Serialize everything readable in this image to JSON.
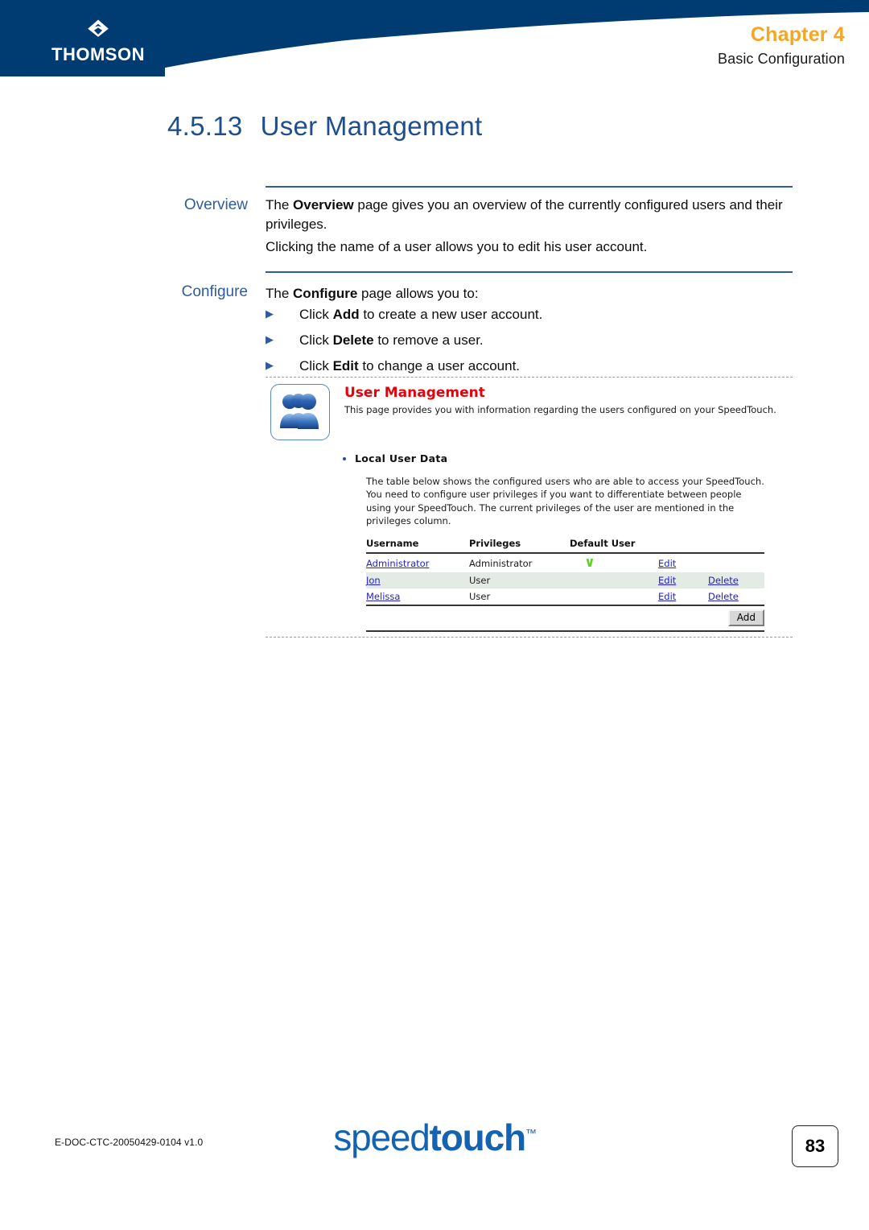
{
  "header": {
    "brand": "THOMSON",
    "brand_mark_icon": "thomson-diamond-icon",
    "chapter_label": "Chapter",
    "chapter_number": "4",
    "chapter_subtitle": "Basic Configuration",
    "chapter_color": "#F5A623",
    "background_color": "#003B71"
  },
  "doc": {
    "section_number": "4.5.13",
    "section_title": "User Management",
    "title_color": "#1F4E8C"
  },
  "overview": {
    "label": "Overview",
    "paragraph_1_pre": "The ",
    "paragraph_1_bold": "Overview",
    "paragraph_1_post": " page gives you an overview of the currently configured users and their privileges.",
    "paragraph_2": "Clicking the name of a user allows you to edit his user account."
  },
  "configure": {
    "label": "Configure",
    "intro_pre": "The ",
    "intro_bold": "Configure",
    "intro_post": " page allows you to:",
    "bullet_marker": "▶",
    "bullets": [
      {
        "pre": "Click ",
        "bold": "Add",
        "post": " to create a new user account."
      },
      {
        "pre": "Click ",
        "bold": "Delete",
        "post": " to remove a user."
      },
      {
        "pre": "Click ",
        "bold": "Edit",
        "post": " to change a user account."
      }
    ]
  },
  "screenshot": {
    "icon": "users-group-icon",
    "title": "User Management",
    "title_color": "#E8000B",
    "lead": "This page provides you with information regarding the users configured on your SpeedTouch.",
    "subsection": "Local User Data",
    "description": "The table below shows the configured users who are able to access your SpeedTouch. You need to configure user privileges if you want to differentiate between people using your SpeedTouch. The current privileges of the user are mentioned in the privileges column.",
    "table": {
      "columns": [
        "Username",
        "Privileges",
        "Default User"
      ],
      "rows": [
        {
          "username": "Administrator",
          "privileges": "Administrator",
          "default_user": "✓",
          "default_user_checked": true,
          "edit": "Edit",
          "delete": "",
          "shaded": false
        },
        {
          "username": "Jon",
          "privileges": "User",
          "default_user": "",
          "default_user_checked": false,
          "edit": "Edit",
          "delete": "Delete",
          "shaded": true
        },
        {
          "username": "Melissa",
          "privileges": "User",
          "default_user": "",
          "default_user_checked": false,
          "edit": "Edit",
          "delete": "Delete",
          "shaded": false
        }
      ],
      "add_button": "Add",
      "check_color": "#5ED223",
      "link_color": "#2222CC"
    }
  },
  "footer": {
    "doc_code": "E-DOC-CTC-20050429-0104 v1.0",
    "logo_light": "speed",
    "logo_bold": "touch",
    "logo_tm": "™",
    "logo_color": "#1463B0",
    "page_number": "83"
  }
}
